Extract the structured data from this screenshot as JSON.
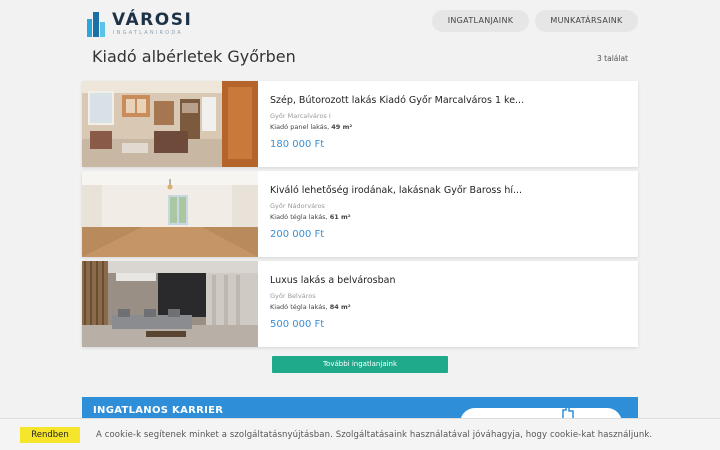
{
  "header": {
    "logo_text": "VÁROSI",
    "logo_sub": "INGATLANIRODA",
    "nav": [
      "INGATLANJAINK",
      "MUNKATÁRSAINK"
    ]
  },
  "page": {
    "title": "Kiadó albérletek Győrben",
    "result_count": "3 találat"
  },
  "listings": [
    {
      "title": "Szép, Bútorozott lakás Kiadó Győr Marcalváros 1 ke...",
      "location": "Győr Marcalváros I",
      "type": "Kiadó panel lakás,",
      "area": "49 m²",
      "price": "180 000 Ft"
    },
    {
      "title": "Kiváló lehetőség irodának, lakásnak Győr Baross hí...",
      "location": "Győr Nádorváros",
      "type": "Kiadó tégla lakás,",
      "area": "61 m²",
      "price": "200 000 Ft"
    },
    {
      "title": "Luxus lakás a belvárosban",
      "location": "Győr Belváros",
      "type": "Kiadó tégla lakás,",
      "area": "84 m²",
      "price": "500 000 Ft"
    }
  ],
  "more_button": "További ingatlanjaink",
  "career": {
    "title": "INGATLANOS KARRIER"
  },
  "cookie": {
    "button": "Rendben",
    "text": "A cookie-k segítenek minket a szolgáltatásnyújtásban. Szolgáltatásaink használatával jóváhagyja, hogy cookie-kat használjunk."
  },
  "colors": {
    "accent_blue": "#3a8fd6",
    "button_green": "#1faa8c",
    "cookie_yellow": "#f5e52b",
    "career_blue": "#2e8fd8"
  }
}
